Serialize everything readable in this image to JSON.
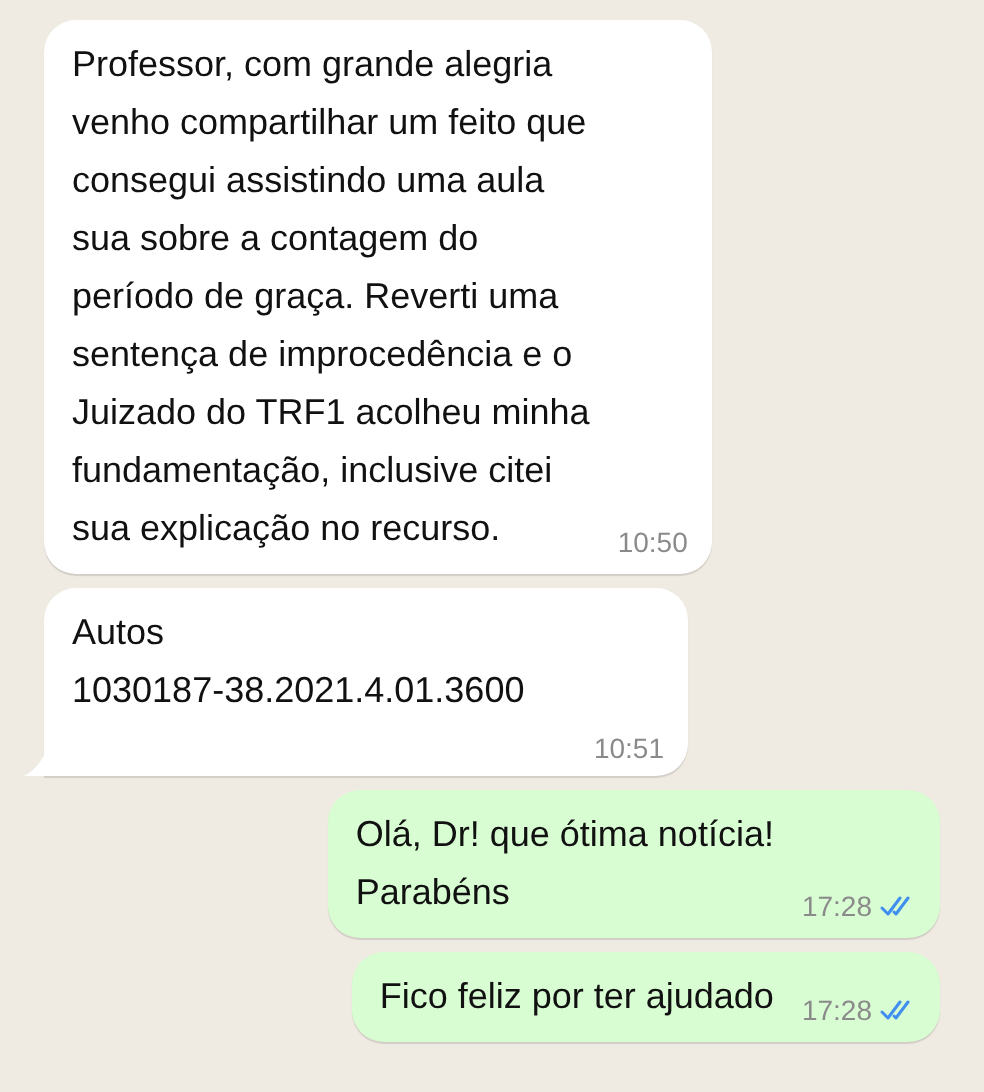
{
  "messages": [
    {
      "kind": "incoming",
      "text": "Professor, com grande alegria\nvenho compartilhar um feito que\nconsegui assistindo uma aula\nsua sobre a contagem do\nperíodo de graça. Reverti uma\nsentença de improcedência e o\nJuizado do TRF1 acolheu minha\nfundamentação, inclusive citei\nsua explicação no recurso.",
      "time": "10:50",
      "tail": false
    },
    {
      "kind": "incoming",
      "text": "Autos\n1030187-38.2021.4.01.3600",
      "time": "10:51",
      "tail": true
    },
    {
      "kind": "outgoing",
      "text": "Olá, Dr! que ótima notícia!\nParabéns",
      "time": "17:28",
      "read": true,
      "tail": false
    },
    {
      "kind": "outgoing",
      "text": "Fico feliz por ter ajudado",
      "time": "17:28",
      "read": true,
      "tail": false
    }
  ]
}
